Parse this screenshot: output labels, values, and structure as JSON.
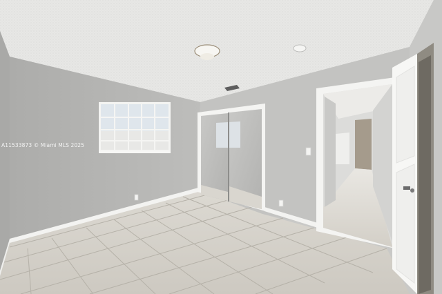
{
  "photo": {
    "scene": "empty-bedroom",
    "watermark_text": "A11533873 © Miami MLS 2025"
  },
  "colors": {
    "ceiling": "#e6e6e4",
    "left_wall": "#b9b9b7",
    "back_wall": "#c4c4c2",
    "right_wall": "#c7c7c5",
    "floor_tile": "#d6d3cc",
    "grout": "#b3afa6",
    "baseboard": "#f2f2f0",
    "door": "#f7f7f5",
    "hall_wall": "#a59b8c"
  }
}
